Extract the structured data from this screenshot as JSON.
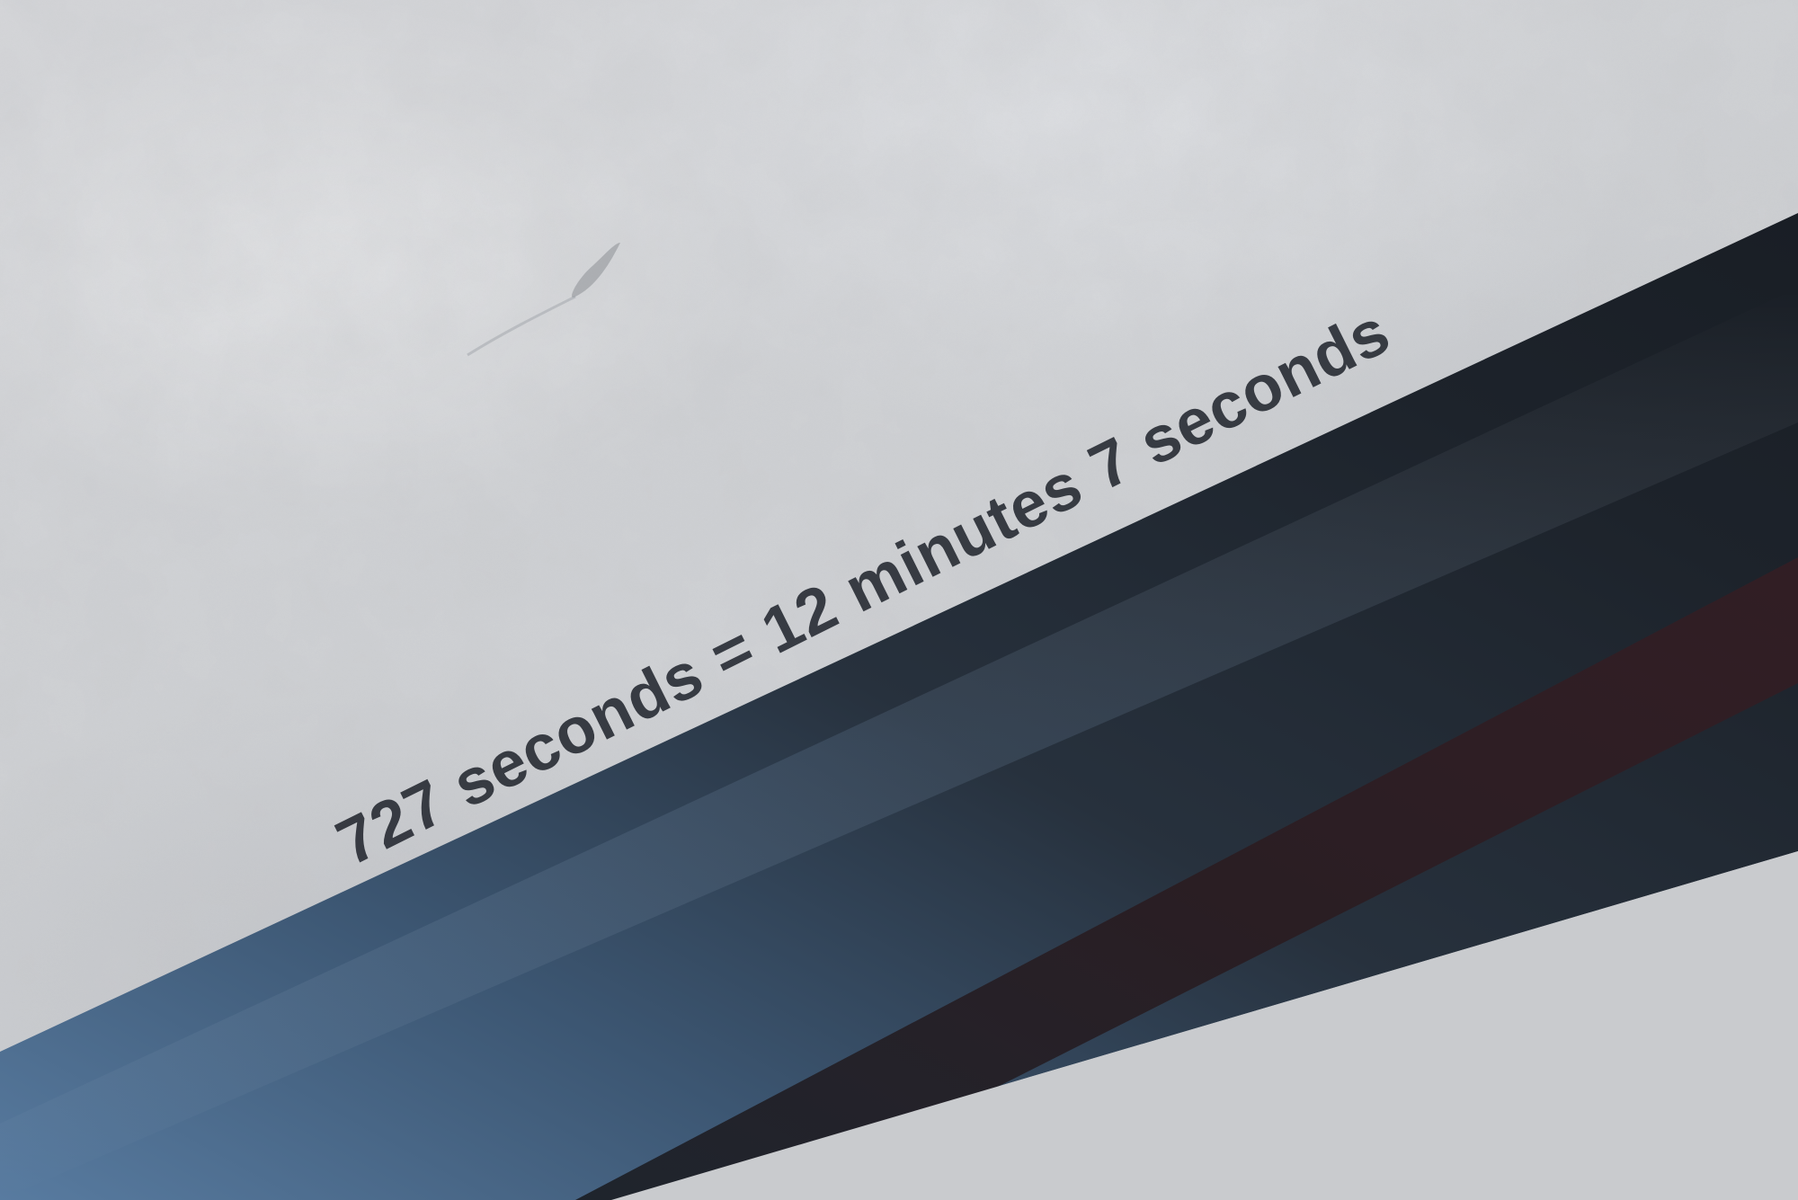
{
  "photo": {
    "caption": "727 seconds = 12 minutes 7 seconds",
    "colors": {
      "surface": "#cfd1d4",
      "band_dark": "#1f2731",
      "band_blue": "#4e6f92",
      "stripe_dark_red": "#2a1a1d",
      "text": "#2b2f37"
    }
  }
}
